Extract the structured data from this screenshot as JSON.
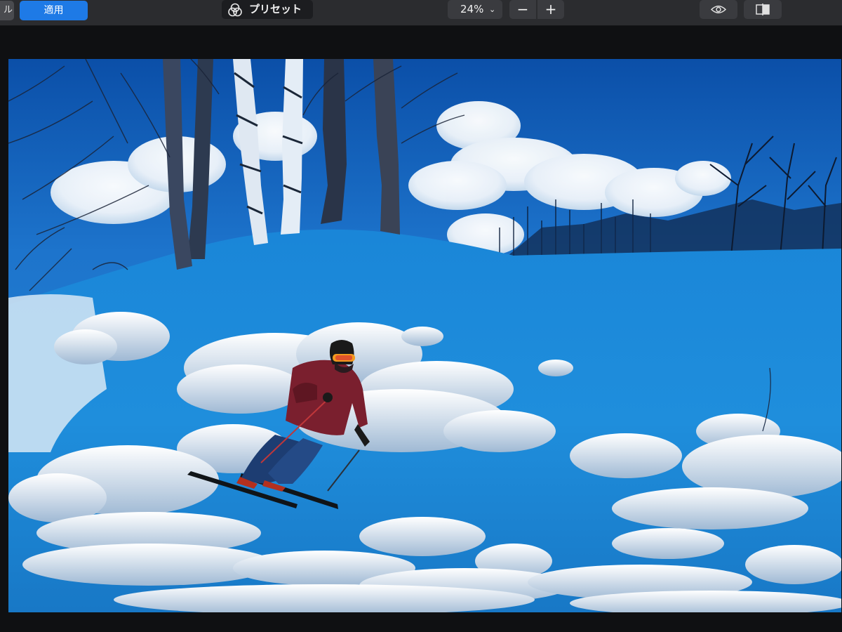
{
  "toolbar": {
    "cancel_label": "ル",
    "apply_label": "適用",
    "preset_label": "プリセット",
    "zoom_value": "24%",
    "zoom_out_symbol": "−",
    "zoom_in_symbol": "+"
  },
  "icons": {
    "preset": "color-filters-icon",
    "zoom_menu": "chevron-down-icon",
    "preview": "eye-icon",
    "compare": "split-compare-icon"
  },
  "colors": {
    "apply_button": "#1e7ae6",
    "toolbar_background": "#2b2c2f",
    "canvas_background": "#0f1012"
  },
  "photo": {
    "description_tag": "edited-photo"
  }
}
